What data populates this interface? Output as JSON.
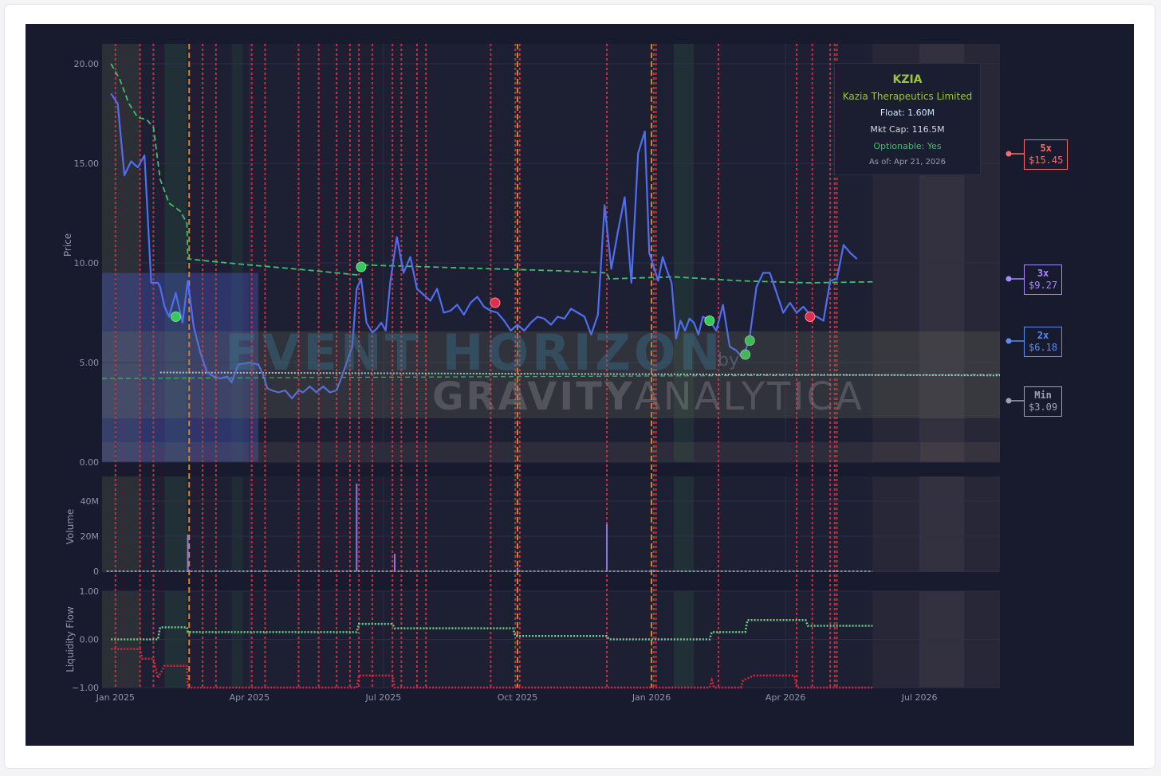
{
  "info": {
    "ticker": "KZIA",
    "company": "Kazia Therapeutics Limited",
    "float": "Float: 1.60M",
    "mktcap": "Mkt Cap: 116.5M",
    "optionable": "Optionable: Yes",
    "asof": "As of: Apr 21, 2026"
  },
  "levels": [
    {
      "name": "5x",
      "value": "$15.45",
      "color": "#ff6b6b",
      "price": 15.45
    },
    {
      "name": "3x",
      "value": "$9.27",
      "color": "#a78bfa",
      "price": 9.27
    },
    {
      "name": "2x",
      "value": "$6.18",
      "color": "#5b8def",
      "price": 6.18
    },
    {
      "name": "Min",
      "value": "$3.09",
      "color": "#9ca3af",
      "price": 3.09
    }
  ],
  "watermark": {
    "line1": "EVENT HORIZON",
    "by": "by",
    "line2a": "GRAVITY",
    "line2b": "ANALYTICA"
  },
  "chart_data": [
    {
      "type": "line",
      "name": "price",
      "ylabel": "Price",
      "ylim": [
        0,
        21
      ],
      "yticks": [
        "0.00",
        "5.00",
        "10.00",
        "15.00",
        "20.00"
      ],
      "xticks": [
        "Jan 2025",
        "Apr 2025",
        "Jul 2025",
        "Oct 2025",
        "Jan 2026",
        "Apr 2026",
        "Jul 2026"
      ],
      "x_range_months": [
        -0.3,
        19.8
      ],
      "x": [
        -0.1,
        0.05,
        0.2,
        0.35,
        0.5,
        0.65,
        0.8,
        0.95,
        1.0,
        1.1,
        1.2,
        1.35,
        1.5,
        1.62,
        1.75,
        1.9,
        2.05,
        2.2,
        2.35,
        2.5,
        2.6,
        2.75,
        3.0,
        3.2,
        3.3,
        3.4,
        3.5,
        3.65,
        3.8,
        3.95,
        4.1,
        4.2,
        4.35,
        4.5,
        4.65,
        4.8,
        4.95,
        5.1,
        5.3,
        5.4,
        5.5,
        5.62,
        5.75,
        5.85,
        5.95,
        6.05,
        6.15,
        6.3,
        6.45,
        6.6,
        6.75,
        6.9,
        7.05,
        7.2,
        7.35,
        7.5,
        7.65,
        7.8,
        7.95,
        8.1,
        8.25,
        8.4,
        8.55,
        8.7,
        8.85,
        9.0,
        9.15,
        9.3,
        9.45,
        9.6,
        9.75,
        9.9,
        10.05,
        10.2,
        10.35,
        10.5,
        10.65,
        10.8,
        10.95,
        11.1,
        11.25,
        11.4,
        11.55,
        11.7,
        11.85,
        11.95,
        12.05,
        12.15,
        12.25,
        12.35,
        12.45,
        12.55,
        12.65,
        12.75,
        12.85,
        12.95,
        13.05,
        13.15,
        13.3,
        13.45,
        13.6,
        13.75,
        13.9,
        14.05,
        14.2,
        14.35,
        14.5,
        14.65,
        14.8,
        14.95,
        15.1,
        15.25,
        15.4,
        15.55,
        15.7,
        15.85,
        16.0,
        16.15,
        16.3,
        16.45,
        16.6,
        16.75,
        16.9
      ],
      "values": [
        18.5,
        18.0,
        14.4,
        15.1,
        14.8,
        15.4,
        9.0,
        9.0,
        8.8,
        7.8,
        7.3,
        8.5,
        7.0,
        9.1,
        6.8,
        5.5,
        4.5,
        4.3,
        4.2,
        4.3,
        4.0,
        4.9,
        5.0,
        4.9,
        4.4,
        3.7,
        3.6,
        3.5,
        3.6,
        3.2,
        3.6,
        3.5,
        3.8,
        3.5,
        3.8,
        3.5,
        3.6,
        4.5,
        5.8,
        8.7,
        9.2,
        7.0,
        6.5,
        6.7,
        7.0,
        6.6,
        9.0,
        11.3,
        9.5,
        10.3,
        8.7,
        8.4,
        8.1,
        8.7,
        7.5,
        7.6,
        7.9,
        7.4,
        8.0,
        8.3,
        7.8,
        7.6,
        7.5,
        7.1,
        6.6,
        6.9,
        6.6,
        7.0,
        7.3,
        7.2,
        6.9,
        7.3,
        7.2,
        7.7,
        7.5,
        7.3,
        6.4,
        7.4,
        12.9,
        9.7,
        11.6,
        13.3,
        9.0,
        15.5,
        16.6,
        10.5,
        9.8,
        9.1,
        10.3,
        9.6,
        9.0,
        6.2,
        7.1,
        6.6,
        7.2,
        7.0,
        6.4,
        7.3,
        7.1,
        6.6,
        7.9,
        5.8,
        5.6,
        5.2,
        6.3,
        8.8,
        9.5,
        9.5,
        8.5,
        7.5,
        8.0,
        7.5,
        7.8,
        7.4,
        7.3,
        7.1,
        9.1,
        9.2,
        10.9,
        10.5,
        10.2
      ],
      "sma_x": [
        -0.1,
        0.1,
        0.3,
        0.5,
        0.7,
        0.85,
        1.0,
        1.2,
        1.45,
        1.6,
        1.62,
        2.5,
        3.5,
        4.5,
        5.4,
        5.5,
        7.0,
        8.5,
        10.0,
        11.0,
        11.05,
        12.5,
        14.0,
        15.5,
        16.95
      ],
      "sma_values": [
        20.0,
        19.2,
        18.0,
        17.3,
        17.2,
        16.8,
        14.2,
        13.0,
        12.6,
        12.0,
        10.2,
        10.0,
        9.8,
        9.6,
        9.4,
        9.9,
        9.8,
        9.7,
        9.6,
        9.5,
        9.2,
        9.3,
        9.1,
        9.0,
        9.05
      ],
      "support_level": 4.35,
      "markers": [
        {
          "x": 1.35,
          "y": 7.3,
          "kind": "green"
        },
        {
          "x": 5.5,
          "y": 9.8,
          "kind": "green"
        },
        {
          "x": 8.5,
          "y": 8.0,
          "kind": "red"
        },
        {
          "x": 13.3,
          "y": 7.1,
          "kind": "green"
        },
        {
          "x": 14.1,
          "y": 5.4,
          "kind": "green"
        },
        {
          "x": 14.2,
          "y": 6.1,
          "kind": "green"
        },
        {
          "x": 15.55,
          "y": 7.3,
          "kind": "red"
        }
      ],
      "red_event_lines": [
        0.0,
        0.55,
        0.85,
        1.95,
        2.25,
        3.05,
        3.35,
        4.1,
        4.55,
        4.95,
        5.25,
        5.45,
        5.75,
        6.2,
        6.4,
        6.75,
        6.95,
        8.4,
        8.95,
        9.05,
        11.0,
        12.05,
        12.1,
        13.5,
        15.25,
        15.6,
        16.0,
        16.1,
        16.15
      ],
      "orange_event_lines": [
        1.65,
        9.0,
        12.0
      ]
    },
    {
      "type": "bar",
      "name": "volume",
      "ylabel": "Volume",
      "yticks": [
        "0",
        "20M",
        "40M"
      ],
      "ylim": [
        0,
        50
      ],
      "spikes": [
        {
          "x": 1.62,
          "value": 21
        },
        {
          "x": 5.4,
          "value": 50
        },
        {
          "x": 6.25,
          "value": 10
        },
        {
          "x": 9.0,
          "value": 2
        },
        {
          "x": 11.0,
          "value": 27
        }
      ]
    },
    {
      "type": "scatter",
      "name": "liquidity_flow",
      "ylabel": "Liquidity Flow",
      "yticks": [
        "−1.00",
        "0.00",
        "1.00"
      ],
      "ylim": [
        -1.0,
        1.0
      ],
      "green_steps": [
        [
          -0.1,
          0.0
        ],
        [
          0.95,
          0.0
        ],
        [
          1.0,
          0.25
        ],
        [
          1.6,
          0.25
        ],
        [
          1.62,
          0.15
        ],
        [
          5.4,
          0.15
        ],
        [
          5.45,
          0.32
        ],
        [
          6.2,
          0.32
        ],
        [
          6.25,
          0.23
        ],
        [
          8.9,
          0.23
        ],
        [
          8.95,
          0.07
        ],
        [
          11.0,
          0.07
        ],
        [
          11.05,
          0.0
        ],
        [
          13.3,
          0.0
        ],
        [
          13.35,
          0.15
        ],
        [
          14.1,
          0.15
        ],
        [
          14.15,
          0.4
        ],
        [
          15.45,
          0.4
        ],
        [
          15.5,
          0.28
        ],
        [
          16.95,
          0.28
        ]
      ],
      "red_steps": [
        [
          -0.1,
          -0.2
        ],
        [
          0.55,
          -0.2
        ],
        [
          0.6,
          -0.4
        ],
        [
          0.85,
          -0.4
        ],
        [
          0.95,
          -0.8
        ],
        [
          1.1,
          -0.55
        ],
        [
          1.6,
          -0.55
        ],
        [
          1.62,
          -1.0
        ],
        [
          5.4,
          -1.0
        ],
        [
          5.45,
          -0.75
        ],
        [
          6.2,
          -0.75
        ],
        [
          6.25,
          -1.0
        ],
        [
          13.3,
          -1.0
        ],
        [
          13.35,
          -0.85
        ],
        [
          13.4,
          -1.0
        ],
        [
          14.0,
          -1.0
        ],
        [
          14.05,
          -0.85
        ],
        [
          14.3,
          -0.75
        ],
        [
          15.2,
          -0.75
        ],
        [
          15.25,
          -1.0
        ],
        [
          16.95,
          -1.0
        ]
      ]
    }
  ]
}
